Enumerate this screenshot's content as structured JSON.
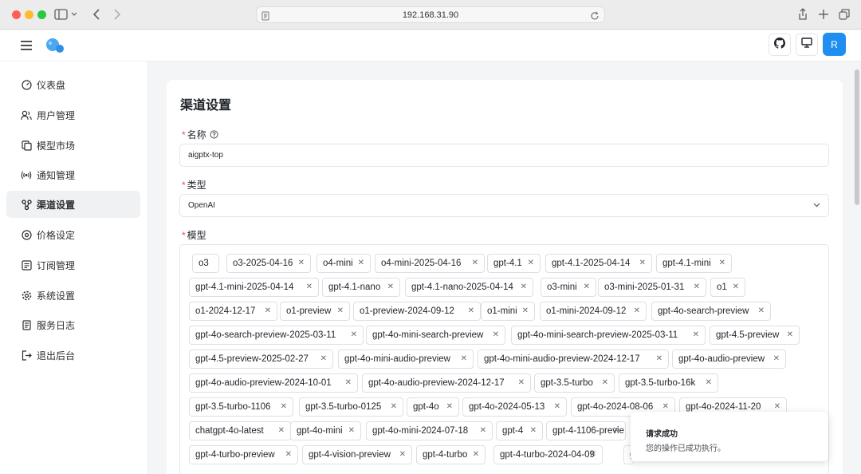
{
  "browser": {
    "url": "192.168.31.90"
  },
  "header": {
    "avatar_initial": "R",
    "icons": [
      "menu-icon",
      "app-logo",
      "github-icon",
      "monitor-icon"
    ]
  },
  "sidebar": {
    "items": [
      {
        "label": "仪表盘",
        "icon": "gauge-icon",
        "active": false
      },
      {
        "label": "用户管理",
        "icon": "users-icon",
        "active": false
      },
      {
        "label": "模型市场",
        "icon": "copy-icon",
        "active": false
      },
      {
        "label": "通知管理",
        "icon": "broadcast-icon",
        "active": false
      },
      {
        "label": "渠道设置",
        "icon": "channels-icon",
        "active": true
      },
      {
        "label": "价格设定",
        "icon": "price-icon",
        "active": false
      },
      {
        "label": "订阅管理",
        "icon": "subscription-icon",
        "active": false
      },
      {
        "label": "系统设置",
        "icon": "gear-icon",
        "active": false
      },
      {
        "label": "服务日志",
        "icon": "log-icon",
        "active": false
      },
      {
        "label": "退出后台",
        "icon": "logout-icon",
        "active": false
      }
    ]
  },
  "form": {
    "title": "渠道设置",
    "name_label": "名称",
    "name_value": "aigptx-top",
    "type_label": "类型",
    "type_value": "OpenAI",
    "models_label": "模型",
    "models": [
      "o3",
      "o3-2025-04-16",
      "o4-mini",
      "o4-mini-2025-04-16",
      "gpt-4.1",
      "gpt-4.1-2025-04-14",
      "gpt-4.1-mini",
      "gpt-4.1-mini-2025-04-14",
      "gpt-4.1-nano",
      "gpt-4.1-nano-2025-04-14",
      "o3-mini",
      "o3-mini-2025-01-31",
      "o1",
      "o1-2024-12-17",
      "o1-preview",
      "o1-preview-2024-09-12",
      "o1-mini",
      "o1-mini-2024-09-12",
      "gpt-4o-search-preview",
      "gpt-4o-search-preview-2025-03-11",
      "gpt-4o-mini-search-preview",
      "gpt-4o-mini-search-preview-2025-03-11",
      "gpt-4.5-preview",
      "gpt-4.5-preview-2025-02-27",
      "gpt-4o-mini-audio-preview",
      "gpt-4o-mini-audio-preview-2024-12-17",
      "gpt-4o-audio-preview",
      "gpt-4o-audio-preview-2024-10-01",
      "gpt-4o-audio-preview-2024-12-17",
      "gpt-3.5-turbo",
      "gpt-3.5-turbo-16k",
      "gpt-3.5-turbo-1106",
      "gpt-3.5-turbo-0125",
      "gpt-4o",
      "gpt-4o-2024-05-13",
      "gpt-4o-2024-08-06",
      "gpt-4o-2024-11-20",
      "chatgpt-4o-latest",
      "gpt-4o-mini",
      "gpt-4o-mini-2024-07-18",
      "gpt-4",
      "gpt-4-1106-previe",
      "gpt-4-turbo-preview",
      "gpt-4-vision-preview",
      "gpt-4-turbo",
      "gpt-4-turbo-2024-04-09",
      "g"
    ]
  },
  "toast": {
    "title": "请求成功",
    "message": "您的操作已成功执行。"
  }
}
